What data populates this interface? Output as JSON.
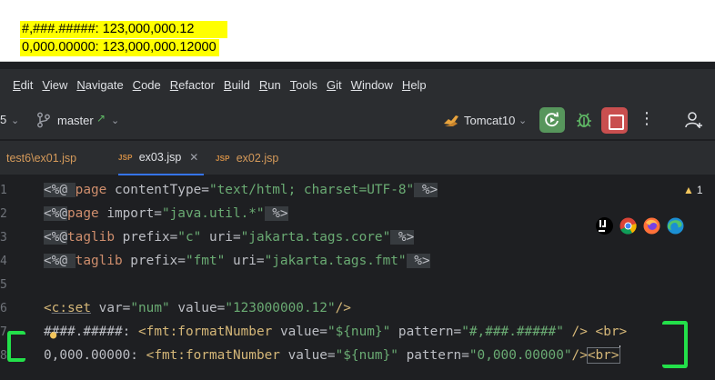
{
  "output": {
    "line1": "#,###.#####: 123,000,000.12",
    "line2": "0,000.00000: 123,000,000.12000"
  },
  "menubar": {
    "items": [
      {
        "accel": "E",
        "rest": "dit"
      },
      {
        "accel": "V",
        "rest": "iew"
      },
      {
        "accel": "N",
        "rest": "avigate"
      },
      {
        "accel": "C",
        "rest": "ode"
      },
      {
        "accel": "R",
        "rest": "efactor"
      },
      {
        "accel": "B",
        "rest": "uild"
      },
      {
        "accel": "R",
        "rest": "un"
      },
      {
        "accel": "T",
        "rest": "ools"
      },
      {
        "accel": "G",
        "rest": "it"
      },
      {
        "accel": "W",
        "rest": "indow"
      },
      {
        "accel": "H",
        "rest": "elp"
      }
    ]
  },
  "toolbar": {
    "project_number": "5",
    "branch": "master",
    "run_config": "Tomcat10"
  },
  "tabs": [
    {
      "label": "test6\\ex01.jsp",
      "badge": "",
      "active": false
    },
    {
      "label": "ex03.jsp",
      "badge": "JSP",
      "active": true
    },
    {
      "label": "ex02.jsp",
      "badge": "JSP",
      "active": false
    }
  ],
  "editor": {
    "warning_count": "1",
    "gutter": [
      "1",
      "2",
      "3",
      "4",
      "5",
      "6",
      "7",
      "8"
    ],
    "lines": {
      "l1": {
        "open": "<%@ ",
        "kw": "page",
        "attr": " contentType=",
        "val": "\"text/html; charset=UTF-8\"",
        "close": " %>"
      },
      "l2": {
        "open": "<%@",
        "kw": "page",
        "attr": " import=",
        "val": "\"java.util.*\"",
        "close": " %>"
      },
      "l3": {
        "open": "<%@",
        "kw": "taglib",
        "a1": " prefix=",
        "v1": "\"c\"",
        "a2": " uri=",
        "v2": "\"jakarta.tags.core\"",
        "close": " %>"
      },
      "l4": {
        "open": "<%@ ",
        "kw": "taglib",
        "a1": " prefix=",
        "v1": "\"fmt\"",
        "a2": " uri=",
        "v2": "\"jakarta.tags.fmt\"",
        "close": " %>"
      },
      "l6": {
        "open": "<",
        "tag": "c:set",
        "a1": " var=",
        "v1": "\"num\"",
        "a2": " value=",
        "v2": "\"123000000.12\"",
        "close": "/>"
      },
      "l7": {
        "text_a": "#",
        "text_b": "###.#####: ",
        "open": "<",
        "tag": "fmt:formatNumber",
        "a1": " value=",
        "v1": "\"${num}\"",
        "a2": " pattern=",
        "v2": "\"#,###.#####\"",
        "close": " />",
        "br": " <br>"
      },
      "l8": {
        "text": "0,000.00000: ",
        "open": "<",
        "tag": "fmt:formatNumber",
        "a1": " value=",
        "v1": "\"${num}\"",
        "a2": " pattern=",
        "v2": "\"0,000.00000\"",
        "close": "/>",
        "br": "<br>"
      }
    }
  },
  "colors": {
    "highlight": "#ffff00",
    "annotation": "#23e04a",
    "run_button": "#57965c",
    "stop_button": "#c94f4f"
  }
}
